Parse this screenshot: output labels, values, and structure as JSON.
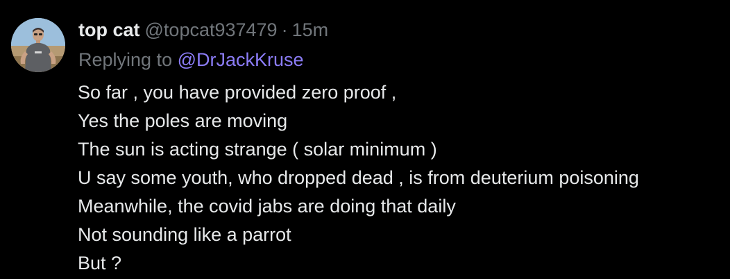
{
  "tweet": {
    "author": {
      "display_name": "top cat",
      "handle": "@topcat937479",
      "separator": "·",
      "time_ago": "15m",
      "avatar_icon": "user-avatar-photo"
    },
    "reply": {
      "prefix": "Replying to",
      "mention": "@DrJackKruse"
    },
    "lines": [
      "So far , you have provided zero proof ,",
      "Yes the poles are moving",
      "The sun is acting strange ( solar minimum )",
      "U say some youth,  who dropped dead , is from deuterium poisoning",
      "Meanwhile,  the covid jabs are doing that daily",
      "Not sounding like a parrot",
      "But ?"
    ]
  },
  "colors": {
    "background": "#000000",
    "primary_text": "#e7e9ea",
    "secondary_text": "#71767b",
    "mention": "#8b7cf6"
  }
}
